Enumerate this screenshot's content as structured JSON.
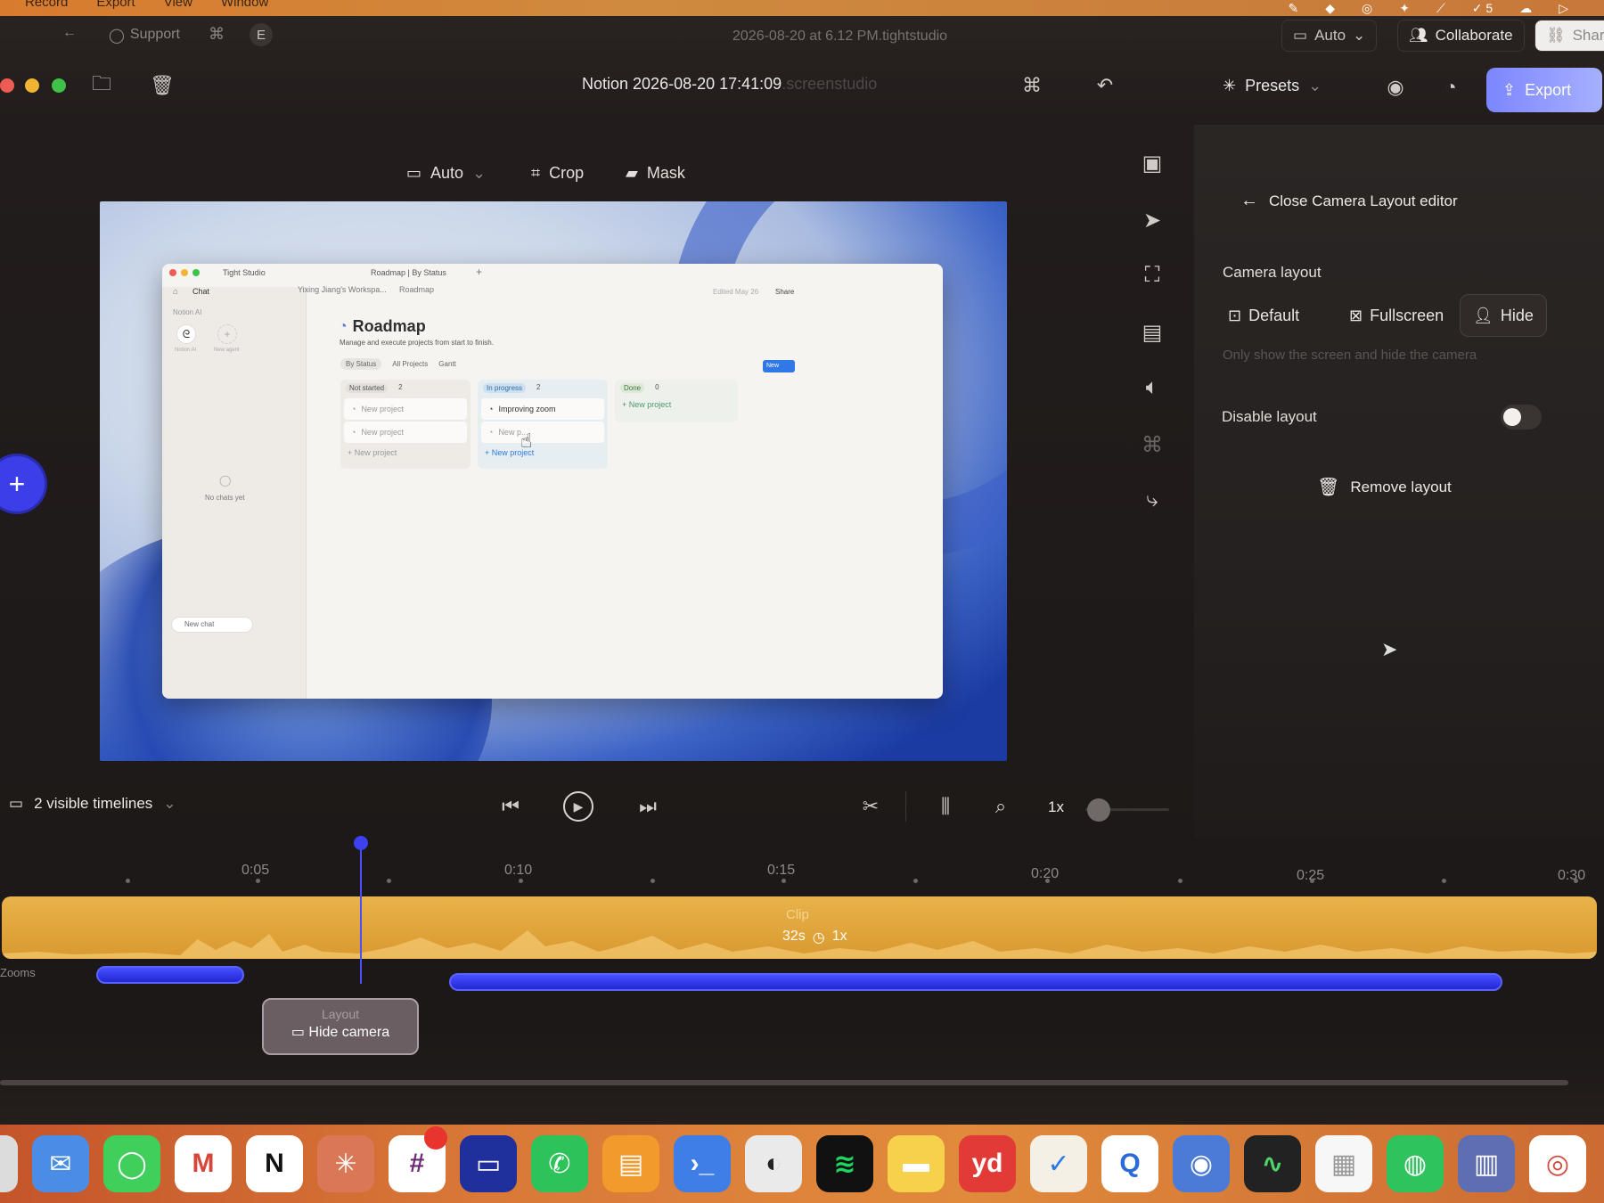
{
  "menubar": {
    "items": [
      "Record",
      "Export",
      "View",
      "Window"
    ],
    "right_count": "5"
  },
  "topbar": {
    "support": "Support",
    "shortcut_letter": "E",
    "document_title": "2026-08-20 at 6.12 PM.tightstudio",
    "auto": "Auto",
    "collaborate": "Collaborate",
    "share": "Shar"
  },
  "titlebar": {
    "title": "Notion 2026-08-20 17:41:09",
    "title_ext": ".screenstudio",
    "presets": "Presets",
    "export": "Export"
  },
  "canvas_toolbar": {
    "auto": "Auto",
    "crop": "Crop",
    "mask": "Mask"
  },
  "recording": {
    "app_name": "Tight Studio",
    "tab_title": "Roadmap | By Status",
    "nav_chat": "Chat",
    "breadcrumb_workspace": "Yixing Jiang's Workspa...",
    "breadcrumb_page": "Roadmap",
    "edited": "Edited May 26",
    "share": "Share",
    "notion_ai_header": "Notion AI",
    "ai_label": "Notion AI",
    "new_agent": "New agent",
    "no_chats": "No chats yet",
    "new_chat": "New chat",
    "page_title": "Roadmap",
    "page_desc": "Manage and execute projects from start to finish.",
    "views": [
      "By Status",
      "All Projects",
      "Gantt"
    ],
    "new_btn": "New",
    "columns": [
      {
        "name": "Not started",
        "count": "2",
        "cards": [
          "New project",
          "New project"
        ],
        "add": "New project"
      },
      {
        "name": "In progress",
        "count": "2",
        "cards": [
          "Improving zoom",
          "New p..."
        ],
        "add": "New project"
      },
      {
        "name": "Done",
        "count": "0",
        "cards": [],
        "add": "New project"
      }
    ]
  },
  "panel": {
    "close_editor": "Close Camera Layout editor",
    "camera_layout": "Camera layout",
    "options": [
      "Default",
      "Fullscreen",
      "Hide"
    ],
    "selected": "Hide",
    "hint": "Only show the screen and hide the camera",
    "disable_layout": "Disable layout",
    "disable_layout_on": false,
    "remove_layout": "Remove layout"
  },
  "timeline_controls": {
    "visible_timelines": "2 visible timelines",
    "speed": "1x"
  },
  "timeline": {
    "ticks": [
      "0:05",
      "0:10",
      "0:15",
      "0:20",
      "0:25",
      "0:30"
    ],
    "clip_label": "Clip",
    "clip_duration": "32s",
    "clip_speed": "1x",
    "zooms_label": "Zooms",
    "layout_label": "Layout",
    "layout_value": "Hide camera"
  },
  "dock": {
    "apps": [
      "finder-icon",
      "mail-icon",
      "messages-icon",
      "gmail-icon",
      "notion-icon",
      "claude-icon",
      "slack-icon",
      "terminal-icon",
      "whatsapp-icon",
      "books-icon",
      "shell-icon",
      "linear-icon",
      "spotify-icon",
      "notes-icon",
      "youdao-icon",
      "tasks-icon",
      "quicktime-icon",
      "scanner-icon",
      "activity-icon",
      "sheet-icon",
      "wechat-icon",
      "colors-icon",
      "chrome-icon"
    ],
    "youdao_label": "yd",
    "notion_label": "N"
  },
  "colors": {
    "accent": "#3b3ff5",
    "export": "#8c95ff",
    "clip": "#e3a63c",
    "zoom": "#2e33e6"
  }
}
